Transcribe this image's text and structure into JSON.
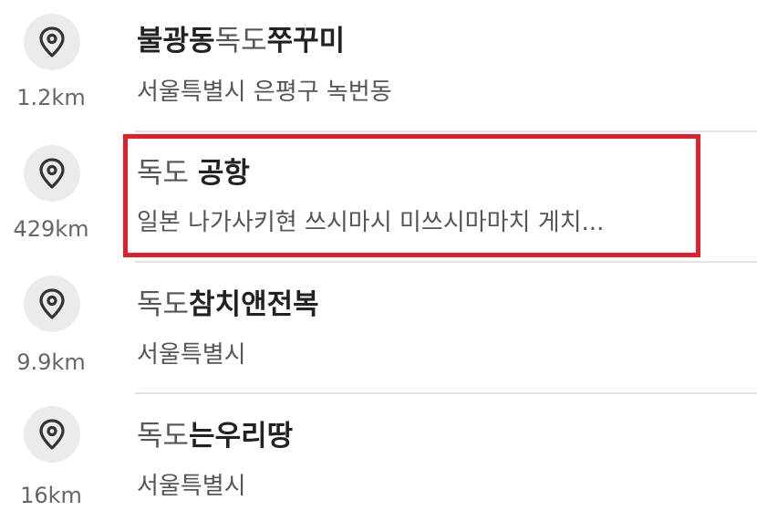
{
  "results": [
    {
      "title_part1": "불광동",
      "title_part2": "독도",
      "title_part3": "쭈꾸미",
      "address": "서울특별시 은평구 녹번동",
      "distance": "1.2km",
      "icon": "location-pin-icon"
    },
    {
      "title_part1": "독도",
      "title_part2": "공항",
      "address": "일본 나가사키현 쓰시마시 미쓰시마마치 게치...",
      "distance": "429km",
      "icon": "location-pin-icon",
      "highlighted": true,
      "highlight_color": "#e0202a"
    },
    {
      "title_part1": "독도",
      "title_part2": "참치앤전복",
      "address": "서울특별시",
      "distance": "9.9km",
      "icon": "location-pin-icon"
    },
    {
      "title_part1": "독도",
      "title_part2": "는우리땅",
      "address": "서울특별시",
      "distance": "16km",
      "icon": "location-pin-icon"
    }
  ]
}
